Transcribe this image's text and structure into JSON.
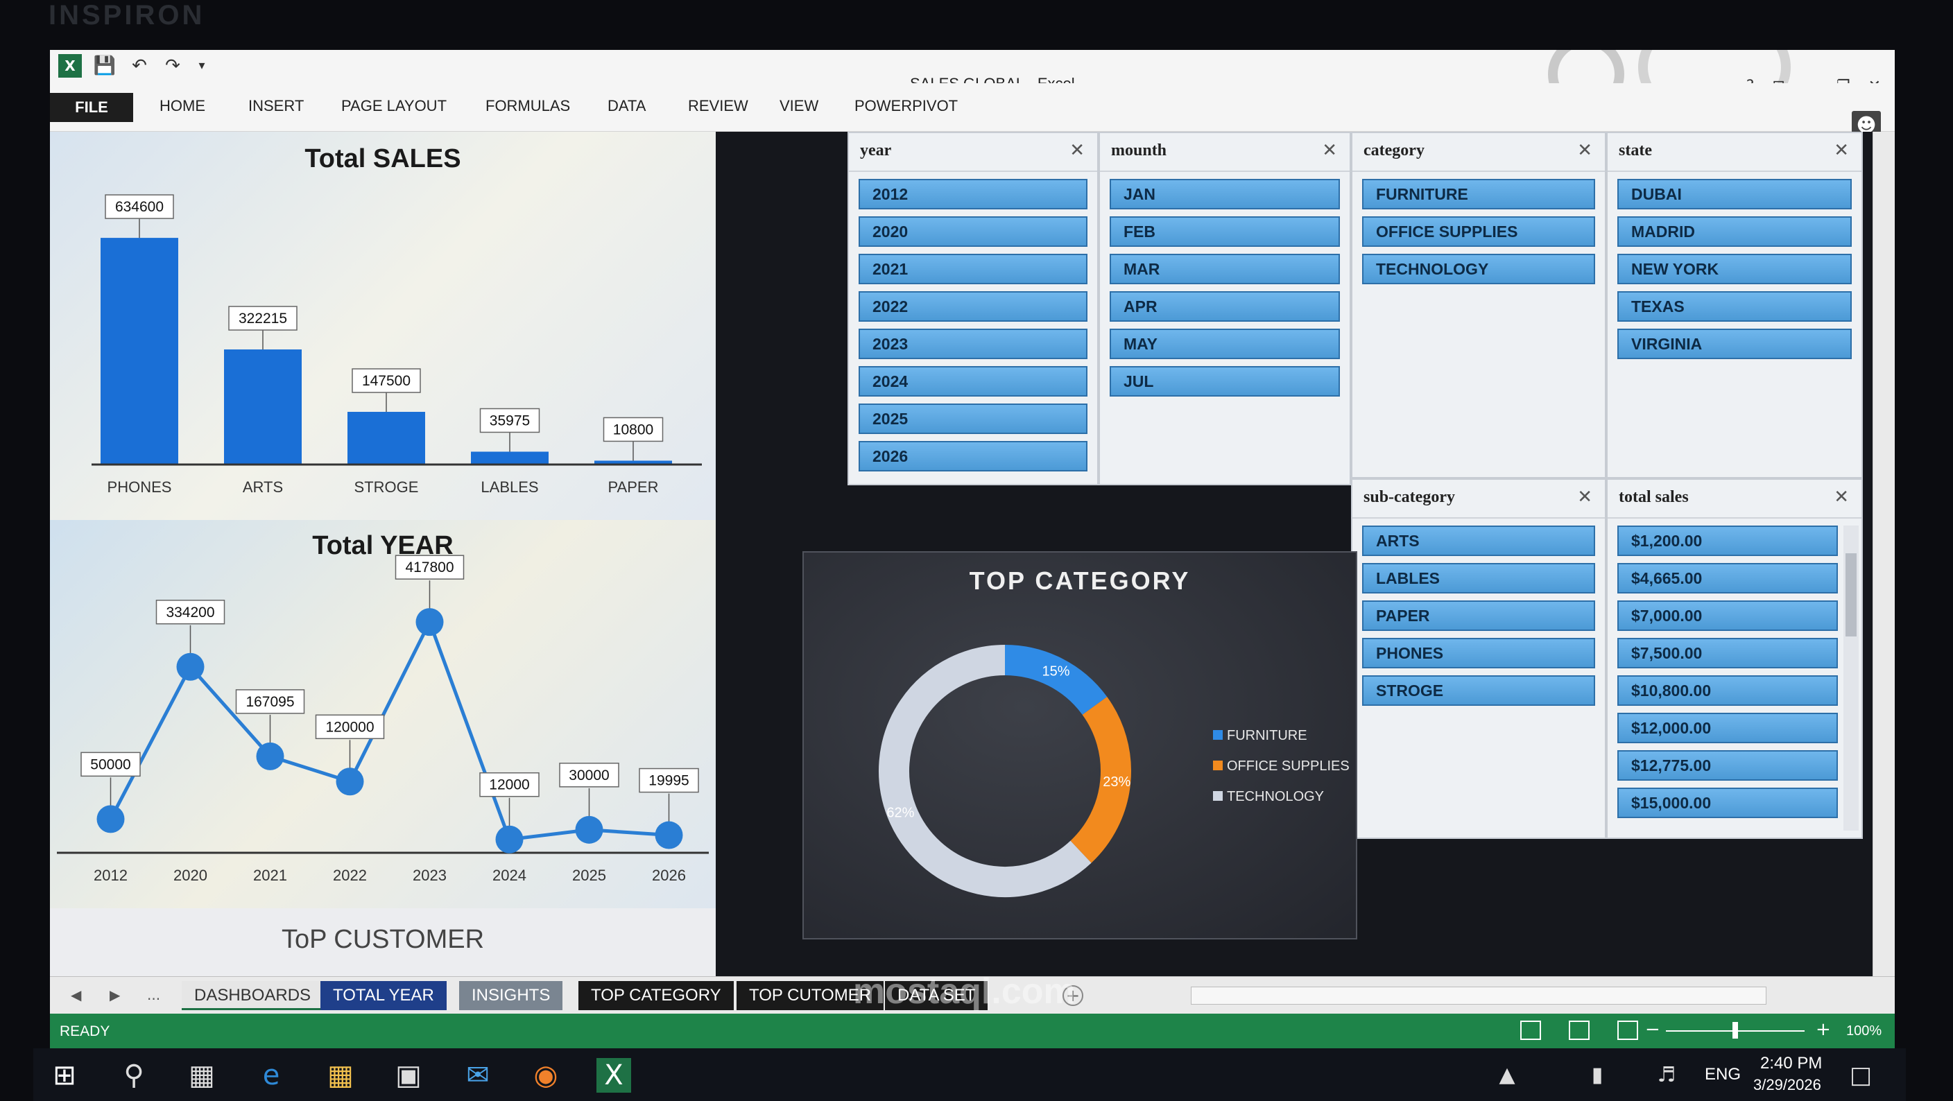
{
  "device_brand": "INSPIRON",
  "window": {
    "title": "SALES GLOBAL - Excel",
    "help": "?",
    "controls": [
      "⊡",
      "—",
      "❐",
      "✕"
    ]
  },
  "ribbon": {
    "tabs": [
      "FILE",
      "HOME",
      "INSERT",
      "PAGE LAYOUT",
      "FORMULAS",
      "DATA",
      "REVIEW",
      "VIEW",
      "POWERPIVOT"
    ]
  },
  "charts": {
    "total_sales": {
      "title": "Total SALES"
    },
    "total_year": {
      "title": "Total YEAR"
    },
    "top_customer": {
      "title": "ToP CUSTOMER"
    },
    "top_category": {
      "title": "TOP CATEGORY"
    }
  },
  "chart_data": [
    {
      "type": "bar",
      "title": "Total SALES",
      "categories": [
        "PHONES",
        "ARTS",
        "STROGE",
        "LABLES",
        "PAPER"
      ],
      "values": [
        634600,
        322215,
        147500,
        35975,
        10800
      ],
      "ylim": [
        0,
        660000
      ],
      "color": "#1a6fd6"
    },
    {
      "type": "line",
      "title": "Total YEAR",
      "categories": [
        "2012",
        "2020",
        "2021",
        "2022",
        "2023",
        "2024",
        "2025",
        "2026"
      ],
      "values": [
        50000,
        334200,
        167095,
        120000,
        417800,
        12000,
        30000,
        19995
      ],
      "ylim": [
        0,
        440000
      ],
      "color": "#2a7ed4"
    },
    {
      "type": "pie",
      "title": "TOP CATEGORY",
      "labels": [
        "FURNITURE",
        "OFFICE SUPPLIES",
        "TECHNOLOGY"
      ],
      "values": [
        15,
        23,
        62
      ],
      "value_labels": [
        "15%",
        "23%",
        "62%"
      ],
      "colors": [
        "#2f8be6",
        "#f28a1e",
        "#cfd6e2"
      ]
    }
  ],
  "slicers": {
    "year": {
      "title": "year",
      "items": [
        "2012",
        "2020",
        "2021",
        "2022",
        "2023",
        "2024",
        "2025",
        "2026"
      ]
    },
    "month": {
      "title": "mounth",
      "items": [
        "JAN",
        "FEB",
        "MAR",
        "APR",
        "MAY",
        "JUL"
      ]
    },
    "category": {
      "title": "category",
      "items": [
        "FURNITURE",
        "OFFICE SUPPLIES",
        "TECHNOLOGY"
      ]
    },
    "state": {
      "title": "state",
      "items": [
        "DUBAI",
        "MADRID",
        "NEW YORK",
        "TEXAS",
        "VIRGINIA"
      ]
    },
    "sub_category": {
      "title": "sub-category",
      "items": [
        "ARTS",
        "LABLES",
        "PAPER",
        "PHONES",
        "STROGE"
      ]
    },
    "total_sales": {
      "title": "total sales",
      "items": [
        "$1,200.00",
        "$4,665.00",
        "$7,000.00",
        "$7,500.00",
        "$10,800.00",
        "$12,000.00",
        "$12,775.00",
        "$15,000.00"
      ]
    }
  },
  "sheet_tabs": {
    "more": "...",
    "add": "+",
    "tabs": [
      {
        "label": "DASHBOARDS",
        "bg": "#e6e6e6",
        "fg": "#333333"
      },
      {
        "label": "TOTAL YEAR",
        "bg": "#1f3f8a",
        "fg": "#ffffff"
      },
      {
        "label": "INSIGHTS",
        "bg": "#7a8591",
        "fg": "#ffffff"
      },
      {
        "label": "TOP CATEGORY",
        "bg": "#1a1a1a",
        "fg": "#ffffff"
      },
      {
        "label": "TOP CUTOMER",
        "bg": "#1a1a1a",
        "fg": "#ffffff"
      },
      {
        "label": "DATA SET",
        "bg": "#1a1a1a",
        "fg": "#ffffff"
      }
    ]
  },
  "status_bar": {
    "status": "READY",
    "zoom_minus": "−",
    "zoom_plus": "+",
    "zoom": "100%",
    "zoom_fraction": 0.5
  },
  "taskbar": {
    "language": "ENG",
    "time": "2:40 PM",
    "date": "3/29/2026"
  },
  "watermark": "mostaql.com"
}
